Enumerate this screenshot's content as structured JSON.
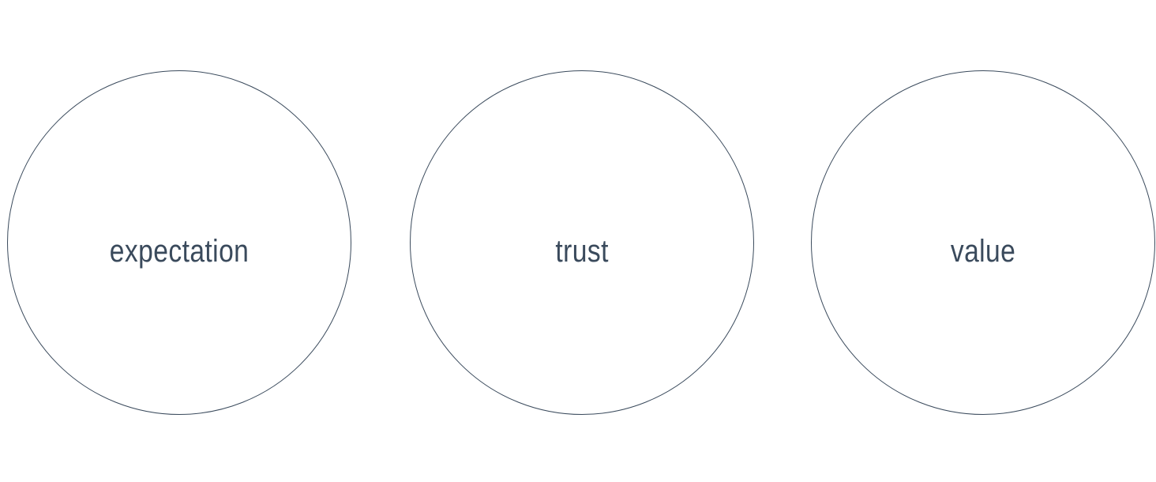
{
  "concepts": [
    {
      "label": "expectation"
    },
    {
      "label": "trust"
    },
    {
      "label": "value"
    }
  ],
  "colors": {
    "stroke": "#3a4a5c",
    "text": "#3a4a5c",
    "background": "#ffffff"
  }
}
